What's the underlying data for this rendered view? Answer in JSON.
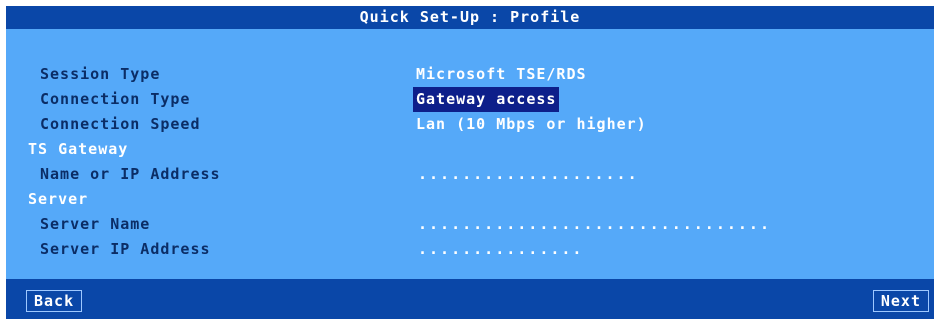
{
  "window": {
    "title": "Quick Set-Up : Profile"
  },
  "form": {
    "session_type": {
      "label": "Session Type",
      "value": "Microsoft TSE/RDS"
    },
    "connection_type": {
      "label": "Connection Type",
      "value": "Gateway access"
    },
    "connection_speed": {
      "label": "Connection Speed",
      "value": "Lan (10 Mbps or higher)"
    },
    "ts_gateway": {
      "heading": "TS Gateway",
      "name_or_ip": {
        "label": "Name or IP Address",
        "placeholder": "...................."
      }
    },
    "server": {
      "heading": "Server",
      "server_name": {
        "label": "Server Name",
        "placeholder": "................................"
      },
      "server_ip": {
        "label": "Server IP Address",
        "placeholder": "..............."
      }
    }
  },
  "footer": {
    "back_label": "Back",
    "next_label": "Next"
  },
  "colors": {
    "panel": "#55a9f9",
    "bar": "#0a47a8",
    "label_text": "#0b2d66",
    "value_text": "#ffffff",
    "selection": "#0d1f8a"
  }
}
